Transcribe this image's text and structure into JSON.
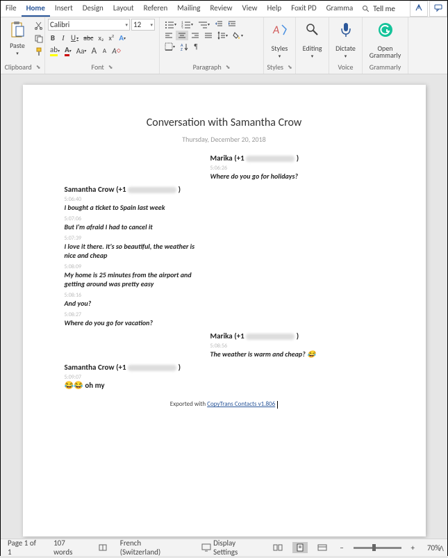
{
  "tabs": [
    "File",
    "Home",
    "Insert",
    "Design",
    "Layout",
    "Referen",
    "Mailing",
    "Review",
    "View",
    "Help",
    "Foxit PD",
    "Gramma"
  ],
  "tellMe": "Tell me",
  "font": {
    "name": "Calibri",
    "size": "12"
  },
  "groups": {
    "clipboard": "Clipboard",
    "font": "Font",
    "paragraph": "Paragraph",
    "styles": "Styles",
    "editing": "Editing",
    "voice": "Voice",
    "grammarly": "Grammarly"
  },
  "big": {
    "paste": "Paste",
    "styles": "Styles",
    "editing": "Editing",
    "dictate": "Dictate",
    "grammarly": "Open\nGrammarly"
  },
  "fbtns": {
    "bold": "B",
    "italic": "I",
    "underline": "U",
    "strike": "abc",
    "sub": "x₂",
    "sup": "x²",
    "clear": "A",
    "case": "Aa",
    "grow": "A",
    "shrink": "A"
  },
  "doc": {
    "title": "Conversation with Samantha Crow",
    "date": "Thursday, December 20, 2018",
    "senders": {
      "marika": "Marika (+1",
      "sam": "Samantha Crow (+1"
    },
    "m1": {
      "ts": "5:06:26",
      "txt": "Where do you go for holidays?"
    },
    "s1": {
      "ts": "5:06:40",
      "txt": "I bought a ticket to Spain last week"
    },
    "s2": {
      "ts": "5:07:06",
      "txt": "But I'm afraid I had to cancel it"
    },
    "s3": {
      "ts": "5:07:39",
      "txt": "I love it there. It's so beautiful, the weather is nice and cheap"
    },
    "s4": {
      "ts": "5:08:09",
      "txt": "My home is 25 minutes from the airport and getting around was pretty easy"
    },
    "s5": {
      "ts": "5:08:16",
      "txt": "And you?"
    },
    "s6": {
      "ts": "5:08:27",
      "txt": "Where do you go for vacation?"
    },
    "m2": {
      "ts": "5:08:56",
      "txt": "The weather is warm and cheap? 😂"
    },
    "s7": {
      "ts": "5:09:07",
      "txt": "😂😂 oh my"
    },
    "exportPrefix": "Exported with ",
    "exportLink": "CopyTrans Contacts v1.806"
  },
  "status": {
    "page": "Page 1 of 1",
    "words": "107 words",
    "lang": "French (Switzerland)",
    "display": "Display Settings",
    "zoom": "70%"
  }
}
